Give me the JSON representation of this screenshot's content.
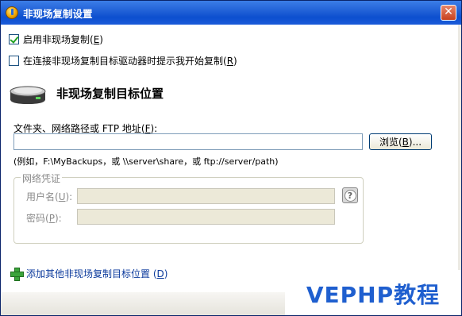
{
  "window": {
    "title": "非现场复制设置",
    "close_glyph": "✕"
  },
  "options": {
    "enable_label": "启用非现场复制(",
    "enable_key": "E",
    "enable_suffix": ")",
    "enable_checked": true,
    "prompt_label": "在连接非现场复制目标驱动器时提示我开始复制(",
    "prompt_key": "R",
    "prompt_suffix": ")",
    "prompt_checked": false
  },
  "section": {
    "heading": "非现场复制目标位置",
    "icon": "drive-icon"
  },
  "path": {
    "label": "文件夹、网络路径或 FTP 地址(",
    "key": "F",
    "suffix": "):",
    "value": "",
    "browse_label": "浏览(",
    "browse_key": "B",
    "browse_suffix": ")...",
    "example": "(例如，F:\\MyBackups，或 \\\\server\\share，或 ftp://server/path)"
  },
  "credentials": {
    "group_title": "网络凭证",
    "username_label": "用户名(",
    "username_key": "U",
    "username_suffix": "):",
    "username_value": "",
    "password_label": "密码(",
    "password_key": "P",
    "password_suffix": "):",
    "password_value": "",
    "help_glyph": "?"
  },
  "add_location": {
    "label": "添加其他非现场复制目标位置 (",
    "key": "D",
    "suffix": ")"
  },
  "watermark": {
    "text": "VEPHP教程"
  },
  "colors": {
    "title_bar": "#0c4fcf",
    "link": "#0b3a9c",
    "watermark": "#1f5fcf"
  }
}
